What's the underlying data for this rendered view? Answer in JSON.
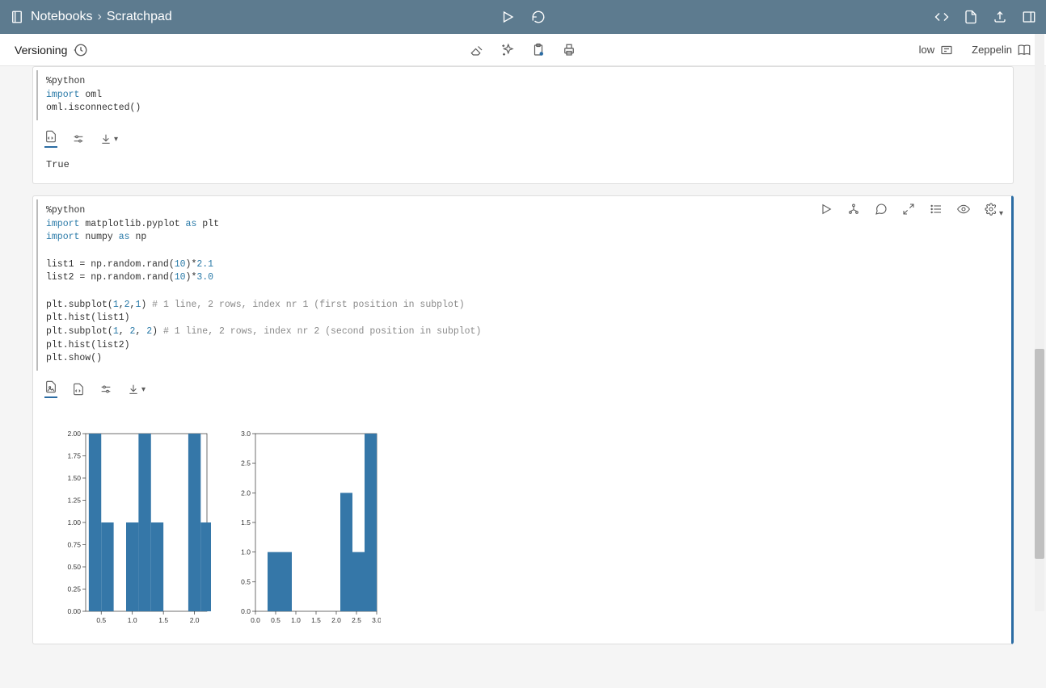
{
  "breadcrumb": {
    "root": "Notebooks",
    "current": "Scratchpad"
  },
  "subbar": {
    "versioning": "Versioning",
    "low": "low",
    "zeppelin": "Zeppelin"
  },
  "cell1": {
    "code_line1_dir": "%python",
    "code_line2_kw": "import",
    "code_line2_mod": " oml",
    "code_line3": "oml.isconnected()",
    "output": "True"
  },
  "cell2": {
    "code_l1": "%python",
    "code_l2_a": "import",
    "code_l2_b": " matplotlib.pyplot ",
    "code_l2_c": "as",
    "code_l2_d": " plt",
    "code_l3_a": "import",
    "code_l3_b": " numpy ",
    "code_l3_c": "as",
    "code_l3_d": " np",
    "code_l5_a": "list1 = np.random.rand(",
    "code_l5_b": "10",
    "code_l5_c": ")*",
    "code_l5_d": "2.1",
    "code_l6_a": "list2 = np.random.rand(",
    "code_l6_b": "10",
    "code_l6_c": ")*",
    "code_l6_d": "3.0",
    "code_l8_a": "plt.subplot(",
    "code_l8_b": "1",
    "code_l8_c": ",",
    "code_l8_d": "2",
    "code_l8_e": ",",
    "code_l8_f": "1",
    "code_l8_g": ") ",
    "code_l8_h": "# 1 line, 2 rows, index nr 1 (first position in subplot)",
    "code_l9": "plt.hist(list1)",
    "code_l10_a": "plt.subplot(",
    "code_l10_b": "1",
    "code_l10_c": ", ",
    "code_l10_d": "2",
    "code_l10_e": ", ",
    "code_l10_f": "2",
    "code_l10_g": ") ",
    "code_l10_h": "# 1 line, 2 rows, index nr 2 (second position in subplot)",
    "code_l11": "plt.hist(list2)",
    "code_l12": "plt.show()"
  },
  "chart_data": [
    {
      "type": "bar",
      "categories": [
        0.5,
        1.0,
        1.5,
        2.0
      ],
      "x_edges": [
        0.3,
        0.5,
        0.7,
        0.9,
        1.1,
        1.3,
        1.5,
        1.7,
        1.9,
        2.1
      ],
      "values": [
        2,
        1,
        0,
        1,
        2,
        1,
        0,
        0,
        2,
        1
      ],
      "xlabel": "",
      "ylabel": "",
      "xlim": [
        0.25,
        2.2
      ],
      "ylim": [
        0,
        2.0
      ],
      "yticks": [
        0.0,
        0.25,
        0.5,
        0.75,
        1.0,
        1.25,
        1.5,
        1.75,
        2.0
      ],
      "xticks": [
        0.5,
        1.0,
        1.5,
        2.0
      ]
    },
    {
      "type": "bar",
      "categories": [
        0.0,
        0.5,
        1.0,
        1.5,
        2.0,
        2.5,
        3.0
      ],
      "x_edges": [
        0.0,
        0.3,
        0.6,
        0.9,
        1.2,
        1.5,
        1.8,
        2.1,
        2.4,
        2.7,
        3.0
      ],
      "values": [
        0,
        1,
        1,
        0,
        0,
        0,
        0,
        2,
        1,
        3
      ],
      "xlabel": "",
      "ylabel": "",
      "xlim": [
        0.0,
        3.0
      ],
      "ylim": [
        0,
        3.0
      ],
      "yticks": [
        0.0,
        0.5,
        1.0,
        1.5,
        2.0,
        2.5,
        3.0
      ],
      "xticks": [
        0.0,
        0.5,
        1.0,
        1.5,
        2.0,
        2.5,
        3.0
      ]
    }
  ]
}
